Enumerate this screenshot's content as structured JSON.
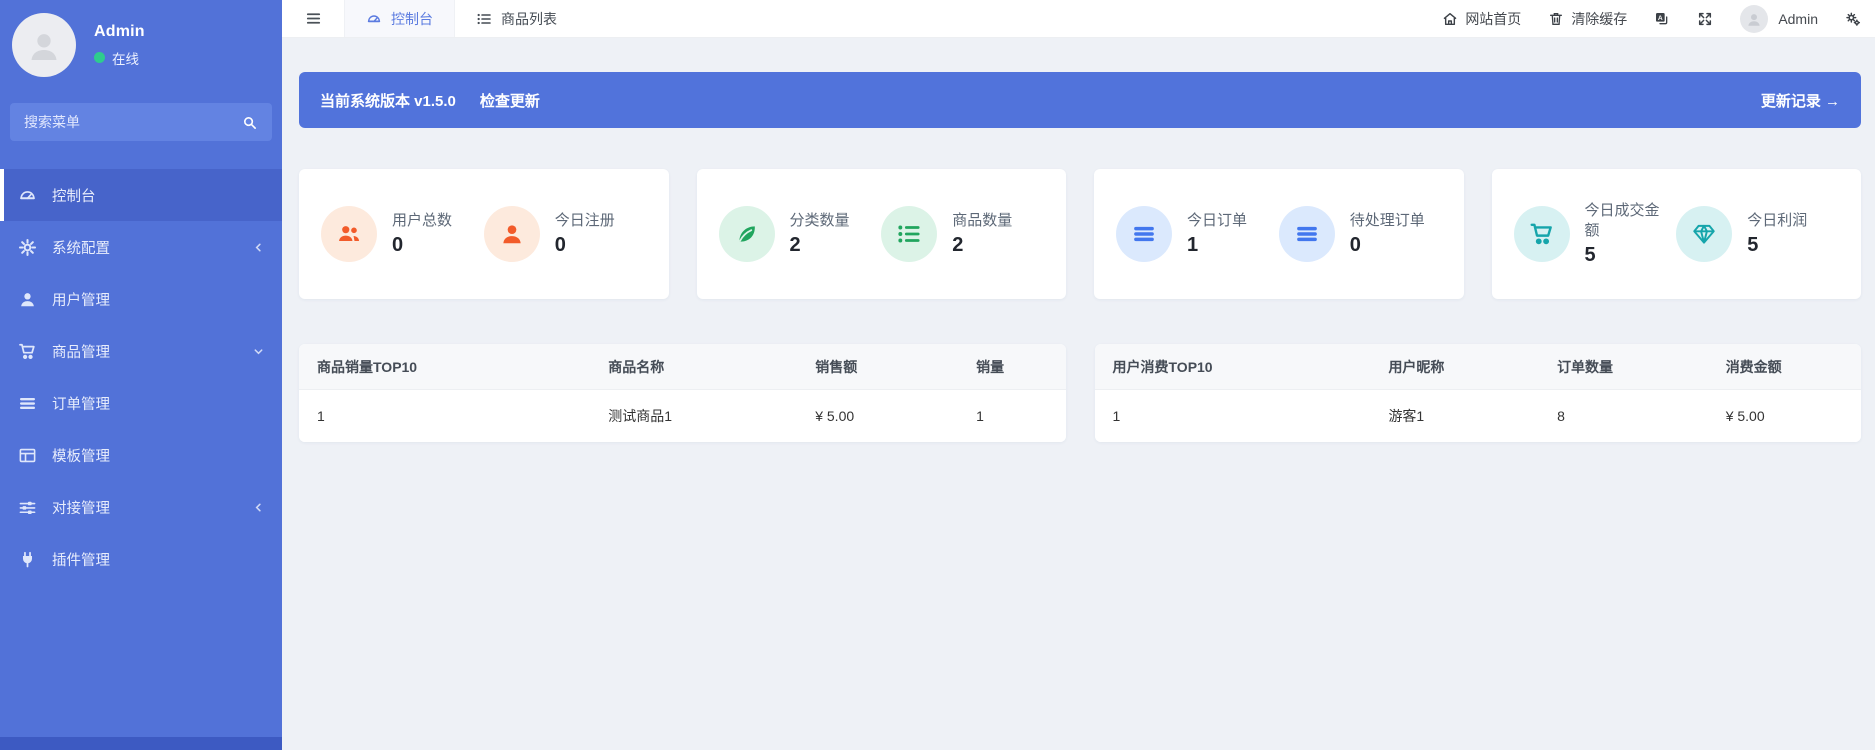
{
  "colors": {
    "sidebar": "#5272d8",
    "banner": "#5173db",
    "orange": "#f25b2a",
    "green": "#21a55e",
    "blue": "#4277ee",
    "teal": "#16a5ab",
    "accent_text": "#5b7be0"
  },
  "sidebar": {
    "user": {
      "name": "Admin",
      "status": "在线"
    },
    "search_placeholder": "搜索菜单",
    "items": [
      {
        "label": "控制台",
        "icon": "gauge-icon",
        "active": true,
        "chevron": null
      },
      {
        "label": "系统配置",
        "icon": "gear-icon",
        "active": false,
        "chevron": "left"
      },
      {
        "label": "用户管理",
        "icon": "user-icon",
        "active": false,
        "chevron": null
      },
      {
        "label": "商品管理",
        "icon": "cart-icon",
        "active": false,
        "chevron": "down"
      },
      {
        "label": "订单管理",
        "icon": "bars-icon",
        "active": false,
        "chevron": null
      },
      {
        "label": "模板管理",
        "icon": "template-icon",
        "active": false,
        "chevron": null
      },
      {
        "label": "对接管理",
        "icon": "sliders-icon",
        "active": false,
        "chevron": "left"
      },
      {
        "label": "插件管理",
        "icon": "plug-icon",
        "active": false,
        "chevron": null
      }
    ]
  },
  "navbar": {
    "tabs": [
      {
        "label": "控制台",
        "icon": "gauge-icon",
        "active": true
      },
      {
        "label": "商品列表",
        "icon": "list-icon",
        "active": false
      }
    ],
    "home_label": "网站首页",
    "clear_cache_label": "清除缓存",
    "user_label": "Admin"
  },
  "banner": {
    "version_text": "当前系统版本 v1.5.0",
    "check_update_label": "检查更新",
    "changelog_label": "更新记录 →"
  },
  "stat_cards": [
    {
      "theme": "orange",
      "stats": [
        {
          "label": "用户总数",
          "value": "0",
          "icon": "users-icon"
        },
        {
          "label": "今日注册",
          "value": "0",
          "icon": "user-icon"
        }
      ]
    },
    {
      "theme": "green",
      "stats": [
        {
          "label": "分类数量",
          "value": "2",
          "icon": "leaf-icon"
        },
        {
          "label": "商品数量",
          "value": "2",
          "icon": "list-icon"
        }
      ]
    },
    {
      "theme": "blue",
      "stats": [
        {
          "label": "今日订单",
          "value": "1",
          "icon": "bars-icon"
        },
        {
          "label": "待处理订单",
          "value": "0",
          "icon": "bars-icon"
        }
      ]
    },
    {
      "theme": "teal",
      "stats": [
        {
          "label": "今日成交金额",
          "value": "5",
          "icon": "cart-icon"
        },
        {
          "label": "今日利润",
          "value": "5",
          "icon": "gem-icon"
        }
      ]
    }
  ],
  "tables": [
    {
      "headers": [
        "商品销量TOP10",
        "商品名称",
        "销售额",
        "销量"
      ],
      "rows": [
        [
          "1",
          "测试商品1",
          "¥ 5.00",
          "1"
        ]
      ]
    },
    {
      "headers": [
        "用户消费TOP10",
        "用户昵称",
        "订单数量",
        "消费金额"
      ],
      "rows": [
        [
          "1",
          "游客1",
          "8",
          "¥ 5.00"
        ]
      ]
    }
  ]
}
